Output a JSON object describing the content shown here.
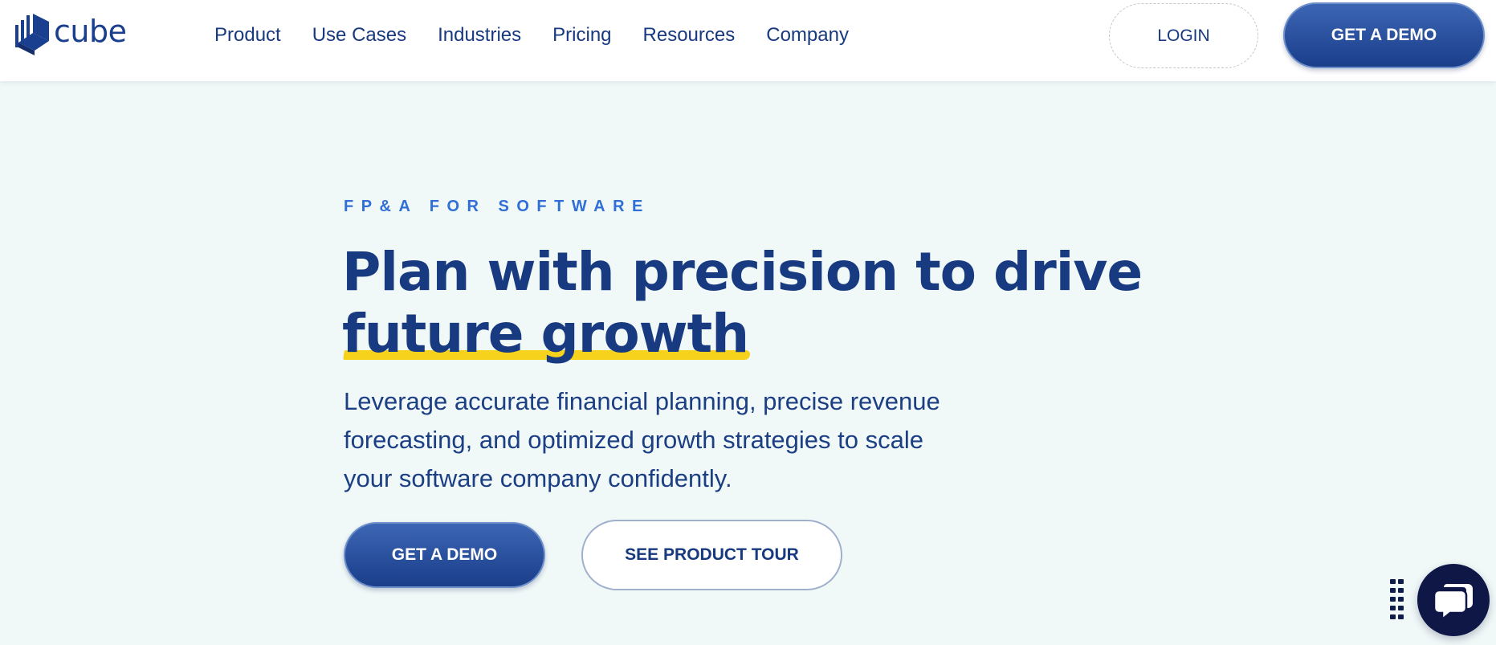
{
  "brand": {
    "name": "cube",
    "color_primary": "#17397f",
    "color_accent": "#2f6fd6",
    "color_highlight": "#f7d21c",
    "logo_icon": "cube-logo-icon"
  },
  "nav": {
    "items": [
      {
        "label": "Product"
      },
      {
        "label": "Use Cases"
      },
      {
        "label": "Industries"
      },
      {
        "label": "Pricing"
      },
      {
        "label": "Resources"
      },
      {
        "label": "Company"
      }
    ],
    "login_label": "LOGIN",
    "demo_label": "GET A DEMO"
  },
  "hero": {
    "eyebrow": "FP&A FOR SOFTWARE",
    "headline_line1": "Plan with precision to drive",
    "headline_highlight": "future growth",
    "subtext": "Leverage accurate financial planning, precise revenue forecasting, and optimized growth strategies to scale your software company confidently.",
    "primary_cta": "GET A DEMO",
    "secondary_cta": "SEE PRODUCT TOUR"
  },
  "chat_widget": {
    "icon": "chat-bubble-icon",
    "handle_icon": "drag-handle-icon",
    "color": "#0f1746"
  }
}
